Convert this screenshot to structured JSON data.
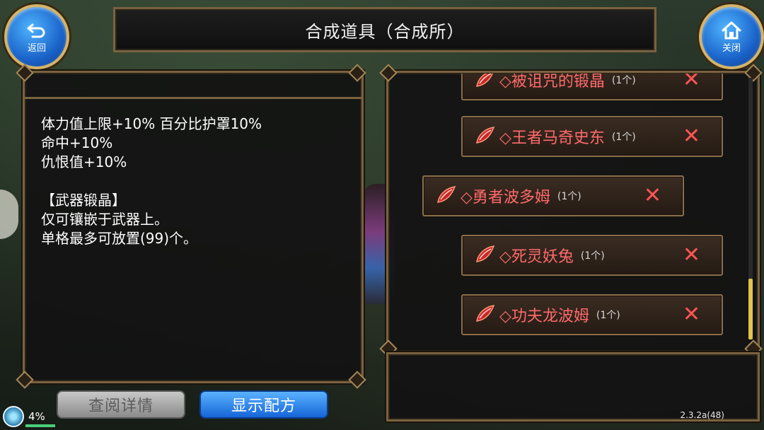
{
  "window": {
    "title": "合成道具（合成所）"
  },
  "nav": {
    "back_label": "返回",
    "close_label": "关闭"
  },
  "info": {
    "lines": "体力值上限+10% 百分比护罩10%\n命中+10%\n仇恨值+10%\n\n【武器锻晶】\n仅可镶嵌于武器上。\n单格最多可放置(99)个。"
  },
  "items": [
    {
      "name": "◇被诅咒的锻晶",
      "count": "(1个)"
    },
    {
      "name": "◇王者马奇史东",
      "count": "(1个)"
    },
    {
      "name": "◇勇者波多姆",
      "count": "(1个)"
    },
    {
      "name": "◇死灵妖兔",
      "count": "(1个)"
    },
    {
      "name": "◇功夫龙波姆",
      "count": "(1个)"
    }
  ],
  "buttons": {
    "details_label": "查阅详情",
    "show_recipe_label": "显示配方"
  },
  "status": {
    "percent": "4%",
    "version": "2.3.2a(48)"
  },
  "colors": {
    "item_name": "#ff6a6a",
    "remove_x": "#ff5555",
    "frame": "#7a6240",
    "scroll_thumb": "#e4c44a"
  },
  "scroll": {
    "position_fraction": 0.77
  }
}
